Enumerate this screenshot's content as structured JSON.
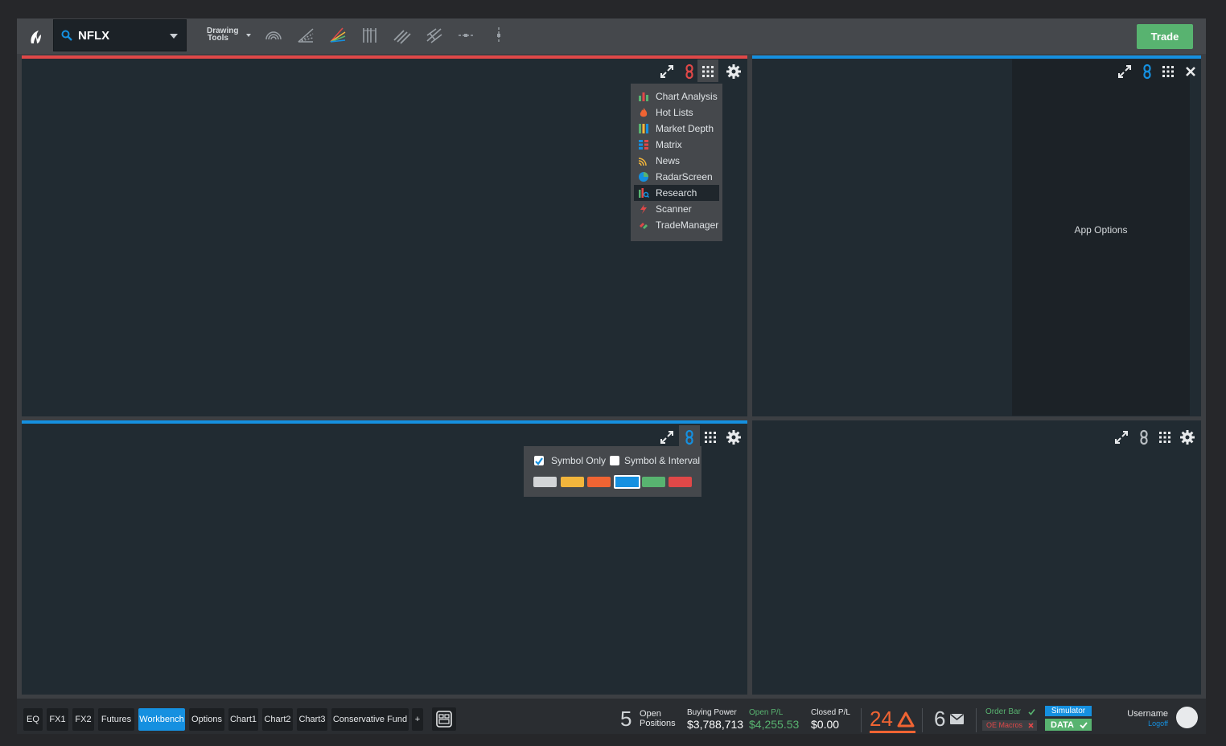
{
  "toolbar": {
    "symbol": "NFLX",
    "drawing_tools_line1": "Drawing",
    "drawing_tools_line2": "Tools",
    "trade_label": "Trade"
  },
  "panels": {
    "top_left": {
      "link_color": "#e04848"
    },
    "top_right": {
      "link_color": "#1590e0",
      "app_options_label": "App Options"
    },
    "bottom_left": {
      "link_color": "#1590e0"
    },
    "bottom_right": {
      "link_color": "#b9bec3"
    }
  },
  "apps_menu": {
    "items": [
      {
        "label": "Chart Analysis",
        "icon": "chart-analysis-icon"
      },
      {
        "label": "Hot Lists",
        "icon": "flame-icon"
      },
      {
        "label": "Market Depth",
        "icon": "market-depth-icon"
      },
      {
        "label": "Matrix",
        "icon": "matrix-icon"
      },
      {
        "label": "News",
        "icon": "rss-icon"
      },
      {
        "label": "RadarScreen",
        "icon": "radar-icon"
      },
      {
        "label": "Research",
        "icon": "research-icon"
      },
      {
        "label": "Scanner",
        "icon": "lightning-icon"
      },
      {
        "label": "TradeManager",
        "icon": "trademanager-icon"
      }
    ],
    "selected": "Research"
  },
  "link_popup": {
    "symbol_only_label": "Symbol Only",
    "symbol_only_checked": true,
    "symbol_interval_label": "Symbol & Interval",
    "symbol_interval_checked": false,
    "colors": [
      "#d3d5d7",
      "#f2b53c",
      "#f06433",
      "#1590e0",
      "#58b370",
      "#e04848"
    ],
    "selected_color": "#1590e0"
  },
  "workspace_tabs": [
    "EQ",
    "FX1",
    "FX2",
    "Futures",
    "Workbench",
    "Options",
    "Chart1",
    "Chart2",
    "Chart3",
    "Conservative Fund",
    "+"
  ],
  "active_tab": "Workbench",
  "status": {
    "open_positions_count": "5",
    "open_positions_label1": "Open",
    "open_positions_label2": "Positions",
    "buying_power_label": "Buying Power",
    "buying_power": "$3,788,713",
    "open_pl_label": "Open P/L",
    "open_pl": "$4,255.53",
    "closed_pl_label": "Closed P/L",
    "closed_pl": "$0.00",
    "alerts_count": "24",
    "messages_count": "6",
    "order_bar_label": "Order Bar",
    "oe_macros_label": "OE Macros",
    "simulator_label": "Simulator",
    "data_label": "DATA",
    "username": "Username",
    "logoff": "Logoff"
  },
  "colors": {
    "green": "#58b370",
    "blue": "#1590e0",
    "red": "#e04848",
    "orange": "#f06433"
  }
}
